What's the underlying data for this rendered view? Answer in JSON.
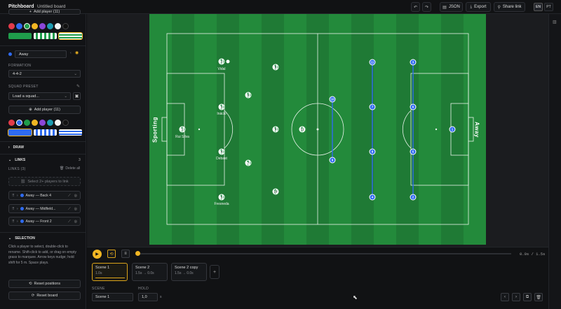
{
  "header": {
    "brand": "Pitchboard",
    "board_name": "Untitled board",
    "json_label": "JSON",
    "export_label": "Export",
    "share_label": "Share link",
    "lang_en": "EN",
    "lang_pt": "PT"
  },
  "sidebar": {
    "top_add_player": "Add player (11)",
    "away_team_name": "Away",
    "formation_label": "FORMATION",
    "formation_value": "4-4-2",
    "squad_preset_label": "SQUAD PRESET",
    "squad_placeholder": "Load a squad...",
    "add_player": "Add player (11)",
    "draw_section": "DRAW",
    "links_section": "LINKS",
    "links_count": "3",
    "links_sub": "LINKS (3)",
    "delete_all": "Delete all",
    "select_hint": "Select 2+ players to link",
    "links": [
      {
        "label": "Away — Back 4"
      },
      {
        "label": "Away — Midfield..."
      },
      {
        "label": "Away — Front 2"
      }
    ],
    "selection_section": "SELECTION",
    "selection_help": "Click a player to select, double-click to rename. Shift-click to add, or drag on empty grass to marquee. Arrow keys nudge; hold shift for 5 m. Space plays.",
    "reset_positions": "Reset positions",
    "reset_board": "Reset board"
  },
  "pitch": {
    "home_team": "Sporting",
    "away_team": "Away",
    "home_players": [
      {
        "number": "1",
        "name": "Rui Silva"
      },
      {
        "number": "2",
        "name": "Vidal"
      },
      {
        "number": "3",
        "name": "Inácio"
      },
      {
        "number": "4",
        "name": "Debast"
      },
      {
        "number": "5",
        "name": "Fresneda"
      },
      {
        "number": "6",
        "name": ""
      },
      {
        "number": "7",
        "name": ""
      },
      {
        "number": "8",
        "name": ""
      },
      {
        "number": "9",
        "name": ""
      },
      {
        "number": "10",
        "name": ""
      },
      {
        "number": "11",
        "name": ""
      }
    ],
    "away_players": [
      "1",
      "2",
      "3",
      "4",
      "5",
      "6",
      "7",
      "8",
      "9",
      "10",
      "11"
    ]
  },
  "timeline": {
    "time_display": "0.0s / 1.5s",
    "scenes": [
      {
        "name": "Scene 1",
        "meta": "1.0s"
      },
      {
        "name": "Scene 2",
        "meta": "1.5s → 0.0s"
      },
      {
        "name": "Scene 2 copy",
        "meta": "1.5s → 0.0s"
      }
    ],
    "scene_label": "SCENE",
    "hold_label": "HOLD",
    "scene_value": "Scene 1",
    "hold_value": "1,0",
    "hold_unit": "s"
  },
  "colors": {
    "away": "#2f6bf0",
    "home": "#1f9d4b",
    "accent": "#f1b623",
    "pitch_dark": "#1f7a35",
    "pitch_light": "#238a3b"
  }
}
